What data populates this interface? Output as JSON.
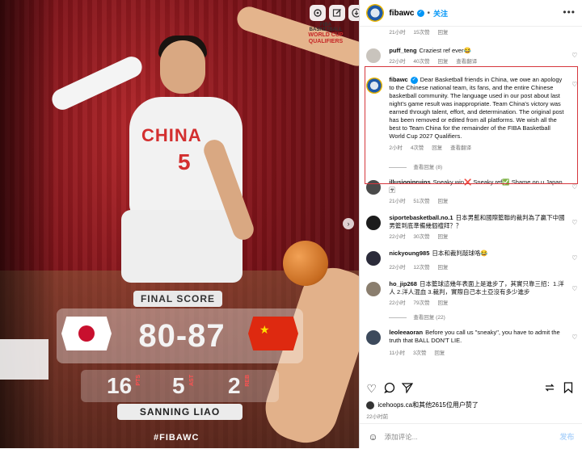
{
  "media": {
    "logo_line1": "FIBA BASKETBALL",
    "logo_line2": "WORLD CUP",
    "logo_line3": "QUALIFIERS",
    "jersey_text": "CHINA",
    "jersey_number": "5",
    "final_score_label": "FINAL SCORE",
    "score": "80-87",
    "stat_points": "16",
    "stat_points_label": "PTS",
    "stat_ast": "5",
    "stat_ast_label": "AST",
    "stat_reb": "2",
    "stat_reb_label": "REB",
    "player_name": "SANNING LIAO",
    "hashtag": "#FIBAWC"
  },
  "header": {
    "username": "fibawc",
    "follow": "关注",
    "more": "•••"
  },
  "comments": [
    {
      "meta": [
        "21小时",
        "15次赞",
        "回复"
      ]
    },
    {
      "user": "puff_teng",
      "text": "Craziest ref ever😂",
      "meta": [
        "22小时",
        "40次赞",
        "回复",
        "查看翻译"
      ]
    },
    {
      "user": "fibawc",
      "text": "Dear Basketball friends in China, we owe an apology to the Chinese national team, its fans, and the entire Chinese basketball community. The language used in our post about last night's game result was inappropriate. Team China's victory was earned through talent, effort, and determination. The original post has been removed or edited from all platforms. We wish all the best to Team China for the remainder of the FIBA Basketball World Cup 2027 Qualifiers.",
      "meta": [
        "2小时",
        "4次赞",
        "回复",
        "查看翻译"
      ],
      "replies": "查看回复 (8)"
    },
    {
      "user": "illusioninruins",
      "text": "Sneaky win❌ Sneaky ref✅ Shame on u Japan🈂",
      "meta": [
        "21小时",
        "51次赞",
        "回复"
      ]
    },
    {
      "user": "siportebasketball.no.1",
      "text": "日本男藍和國際籃聯的裁判為了贏下中國男籃到底準備幾個禮拜？？",
      "meta": [
        "22小时",
        "30次赞",
        "回复"
      ]
    },
    {
      "user": "nickyoung985",
      "text": "日本和裁判敲球咯😂",
      "meta": [
        "22小时",
        "12次赞",
        "回复"
      ]
    },
    {
      "user": "ho_jip268",
      "text": "日本籃球這幾年表面上是進步了，其實只靠三招：1.洋人 2.洋人混血 3.裁判，實際自己本土亞沒有多少進步",
      "meta": [
        "22小时",
        "79次赞",
        "回复"
      ],
      "replies": "查看回复 (22)"
    },
    {
      "user": "leoleeaoran",
      "text": "Before you call us \"sneaky\", you have to admit the truth that BALL DON'T LIE.",
      "meta": [
        "11小时",
        "3次赞",
        "回复"
      ]
    }
  ],
  "footer": {
    "likes_text": "icehoops.ca和其他2615位用户赞了",
    "time": "22小时前",
    "add_comment_placeholder": "添加评论...",
    "post_button": "发布"
  },
  "colors": {
    "accent": "#0095f6",
    "highlight_box": "#d6373d"
  }
}
